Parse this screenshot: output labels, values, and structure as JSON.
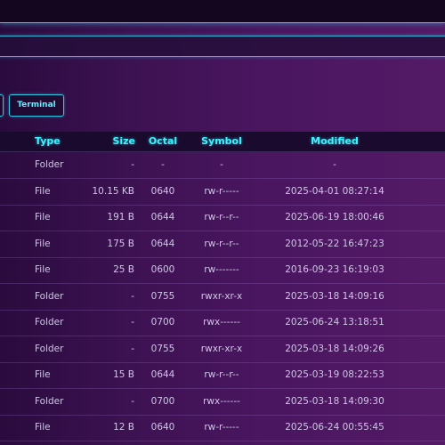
{
  "toolbar": {
    "terminal_label": "Terminal"
  },
  "table": {
    "headers": {
      "type": "Type",
      "size": "Size",
      "octal": "Octal",
      "symbol": "Symbol",
      "modified": "Modified"
    },
    "rows": [
      {
        "type": "Folder",
        "size": "-",
        "octal": "-",
        "symbol": "-",
        "modified": "-"
      },
      {
        "type": "File",
        "size": "10.15 KB",
        "octal": "0640",
        "symbol": "rw-r-----",
        "modified": "2025-04-01 08:27:14"
      },
      {
        "type": "File",
        "size": "191 B",
        "octal": "0644",
        "symbol": "rw-r--r--",
        "modified": "2025-06-19 18:00:46"
      },
      {
        "type": "File",
        "size": "175 B",
        "octal": "0644",
        "symbol": "rw-r--r--",
        "modified": "2012-05-22 16:47:23"
      },
      {
        "type": "File",
        "size": "25 B",
        "octal": "0600",
        "symbol": "rw-------",
        "modified": "2016-09-23 16:19:03"
      },
      {
        "type": "Folder",
        "size": "-",
        "octal": "0755",
        "symbol": "rwxr-xr-x",
        "modified": "2025-03-18 14:09:16"
      },
      {
        "type": "Folder",
        "size": "-",
        "octal": "0700",
        "symbol": "rwx------",
        "modified": "2025-06-24 13:18:51"
      },
      {
        "type": "Folder",
        "size": "-",
        "octal": "0755",
        "symbol": "rwxr-xr-x",
        "modified": "2025-03-18 14:09:26"
      },
      {
        "type": "File",
        "size": "15 B",
        "octal": "0644",
        "symbol": "rw-r--r--",
        "modified": "2025-03-19 08:22:53"
      },
      {
        "type": "Folder",
        "size": "-",
        "octal": "0700",
        "symbol": "rwx------",
        "modified": "2025-03-18 14:09:30"
      },
      {
        "type": "File",
        "size": "12 B",
        "octal": "0640",
        "symbol": "rw-r-----",
        "modified": "2025-06-24 00:55:45"
      }
    ]
  }
}
